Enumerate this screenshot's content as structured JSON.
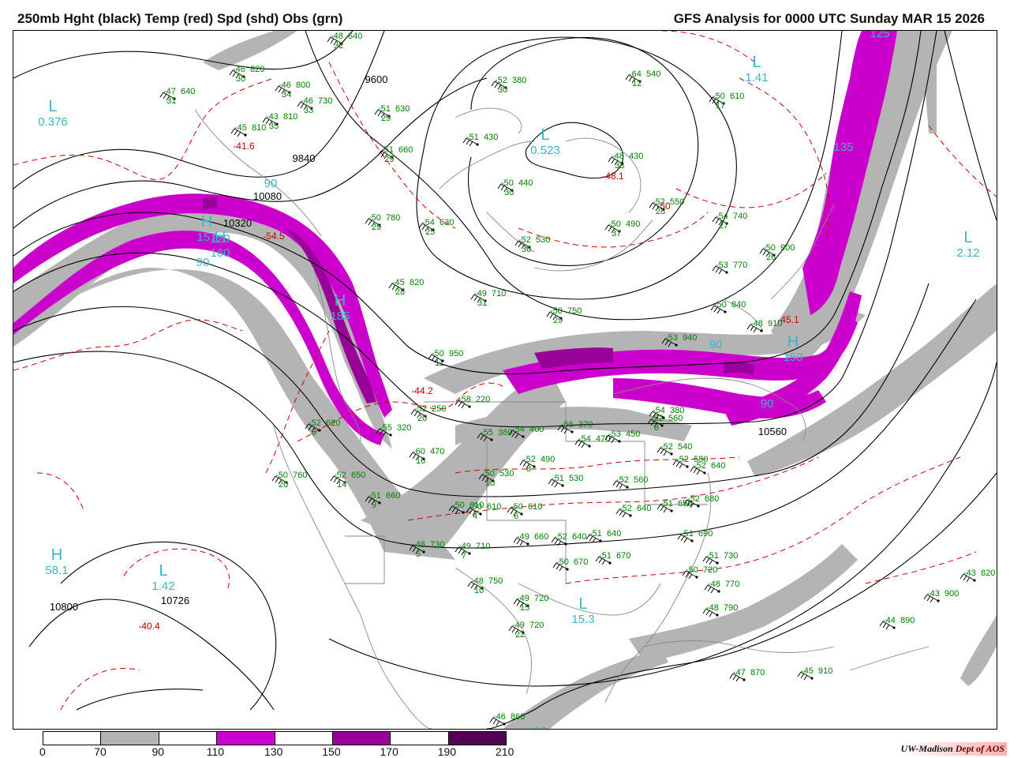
{
  "header": {
    "left_title": "250mb Hght (black) Temp (red) Spd (shd) Obs (grn)",
    "right_title": "GFS Analysis for 0000 UTC Sunday  MAR 15 2026"
  },
  "colorbar": {
    "labels": [
      "0",
      "70",
      "90",
      "110",
      "130",
      "150",
      "170",
      "190",
      "210"
    ],
    "colors": [
      "#ffffff",
      "#b4b4b4",
      "#ffffff",
      "#cc00cc",
      "#ffffff",
      "#990099",
      "#ffffff",
      "#550055"
    ]
  },
  "credit": {
    "left": "UW-Madison",
    "right": "Dept of AOS"
  },
  "map_labels": {
    "centers": [
      {
        "letter": "L",
        "value": "0.376",
        "color": "#3cb4c8"
      },
      {
        "letter": "H",
        "value": "157",
        "color": "#3cb4c8"
      },
      {
        "letter": "H",
        "value": "160",
        "color": "#3cb4c8"
      },
      {
        "letter": "H",
        "value": "185",
        "color": "#3cb4c8"
      },
      {
        "letter": "H",
        "value": "58.1",
        "color": "#3cb4c8"
      },
      {
        "letter": "L",
        "value": "1.42",
        "color": "#3cb4c8"
      },
      {
        "letter": "L",
        "value": "0.523",
        "color": "#3cb4c8"
      },
      {
        "letter": "L",
        "value": "1.41",
        "color": "#3cb4c8"
      },
      {
        "letter": "L",
        "value": "2.12",
        "color": "#3cb4c8"
      },
      {
        "letter": "H",
        "value": "150",
        "color": "#3cb4c8"
      },
      {
        "letter": "L",
        "value": "15.3",
        "color": "#3cb4c8"
      }
    ],
    "speed_labels": [
      "90",
      "90",
      "90",
      "90",
      "125",
      "135",
      "120",
      "90"
    ],
    "height_labels": [
      "9600",
      "9840",
      "10080",
      "10320",
      "10560",
      "10800",
      "10726"
    ],
    "temp_labels": [
      "-54.5",
      "-41.6",
      "-48.1",
      "-44.2",
      "-40.4",
      "-45.1",
      "-50"
    ],
    "obs_samples": [
      "-48 640 32",
      "-46 820 30",
      "-47 640 31",
      "-46 800 34",
      "-46 730 33",
      "-43 810 35",
      "-45 810",
      "-52 380 30",
      "-51 630 29",
      "-51 430",
      "-48 430 33",
      "-64 540 12",
      "-50 610 17",
      "-51 660 29",
      "-50 440 30",
      "-52 550 28",
      "-50 490 37",
      "-54 740 27",
      "-50 780 29",
      "-54 630 25",
      "-52 530 30",
      "-50 900 26",
      "-53 770",
      "-45 820 28",
      "-49 710 31",
      "-50 840",
      "-48 910",
      "-50 750 29",
      "-50 950 11",
      "-53 940",
      "-52 560 8",
      "-52 620 6",
      "-55 320",
      "-50 760 20",
      "-52 650 14",
      "-51 660 9",
      "-60 470 16",
      "-52 250 20",
      "-58 220",
      "-55 380",
      "-54 400",
      "-56 370",
      "-54 470",
      "-53 450",
      "-54 380",
      "-52 490 8",
      "-50 530 10",
      "-51 530",
      "-52 560",
      "-50 610 6",
      "-50 610 4",
      "-50 610",
      "-48 730 5",
      "-49 710 7",
      "-49 660",
      "-52 640",
      "-51 640",
      "-52 640",
      "-51 650",
      "-52 540",
      "-52 580",
      "-52 640",
      "-52 680",
      "-51 690",
      "-51 730",
      "-48 750 10",
      "-49 720 15",
      "-49 720 22",
      "-50 670",
      "-51 670",
      "-50 720",
      "-48 770",
      "-48 790",
      "-43 900",
      "-44 890",
      "-47 870",
      "-45 910",
      "-46 860",
      "-43 820"
    ]
  }
}
